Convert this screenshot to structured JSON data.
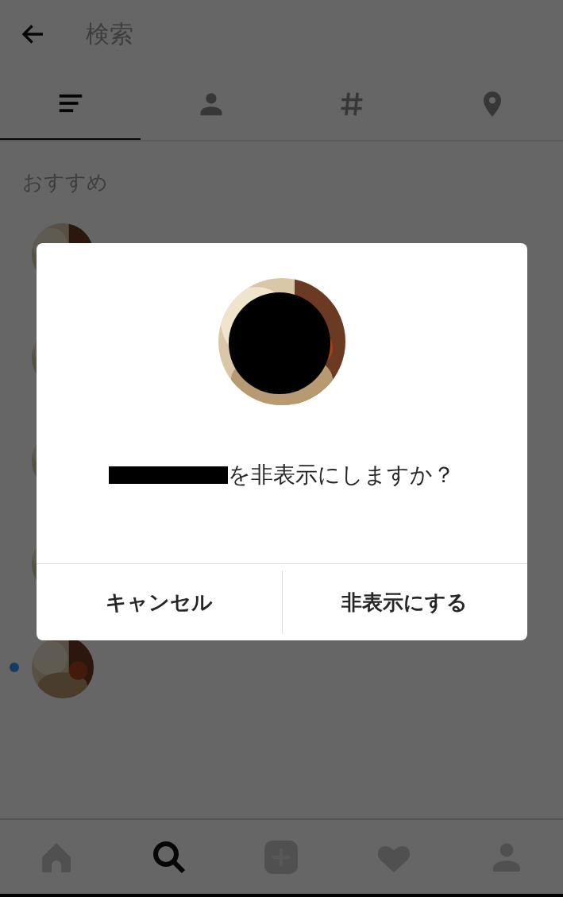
{
  "header": {
    "title": "検索"
  },
  "tabs": [
    {
      "kind": "list",
      "selected": true
    },
    {
      "kind": "person",
      "selected": false
    },
    {
      "kind": "hashtag",
      "selected": false
    },
    {
      "kind": "place",
      "selected": false
    }
  ],
  "section_title": "おすすめ",
  "suggestions": [
    {
      "unread": false
    },
    {
      "unread": false
    },
    {
      "unread": false
    },
    {
      "unread": false
    },
    {
      "unread": true
    }
  ],
  "dialog": {
    "message": "を非表示にしますか？",
    "buttons": [
      "キャンセル",
      "非表示にする"
    ]
  },
  "bottom_nav": [
    {
      "kind": "home",
      "selected": false
    },
    {
      "kind": "search",
      "selected": true
    },
    {
      "kind": "add",
      "selected": false
    },
    {
      "kind": "heart",
      "selected": false
    },
    {
      "kind": "person",
      "selected": false
    }
  ]
}
